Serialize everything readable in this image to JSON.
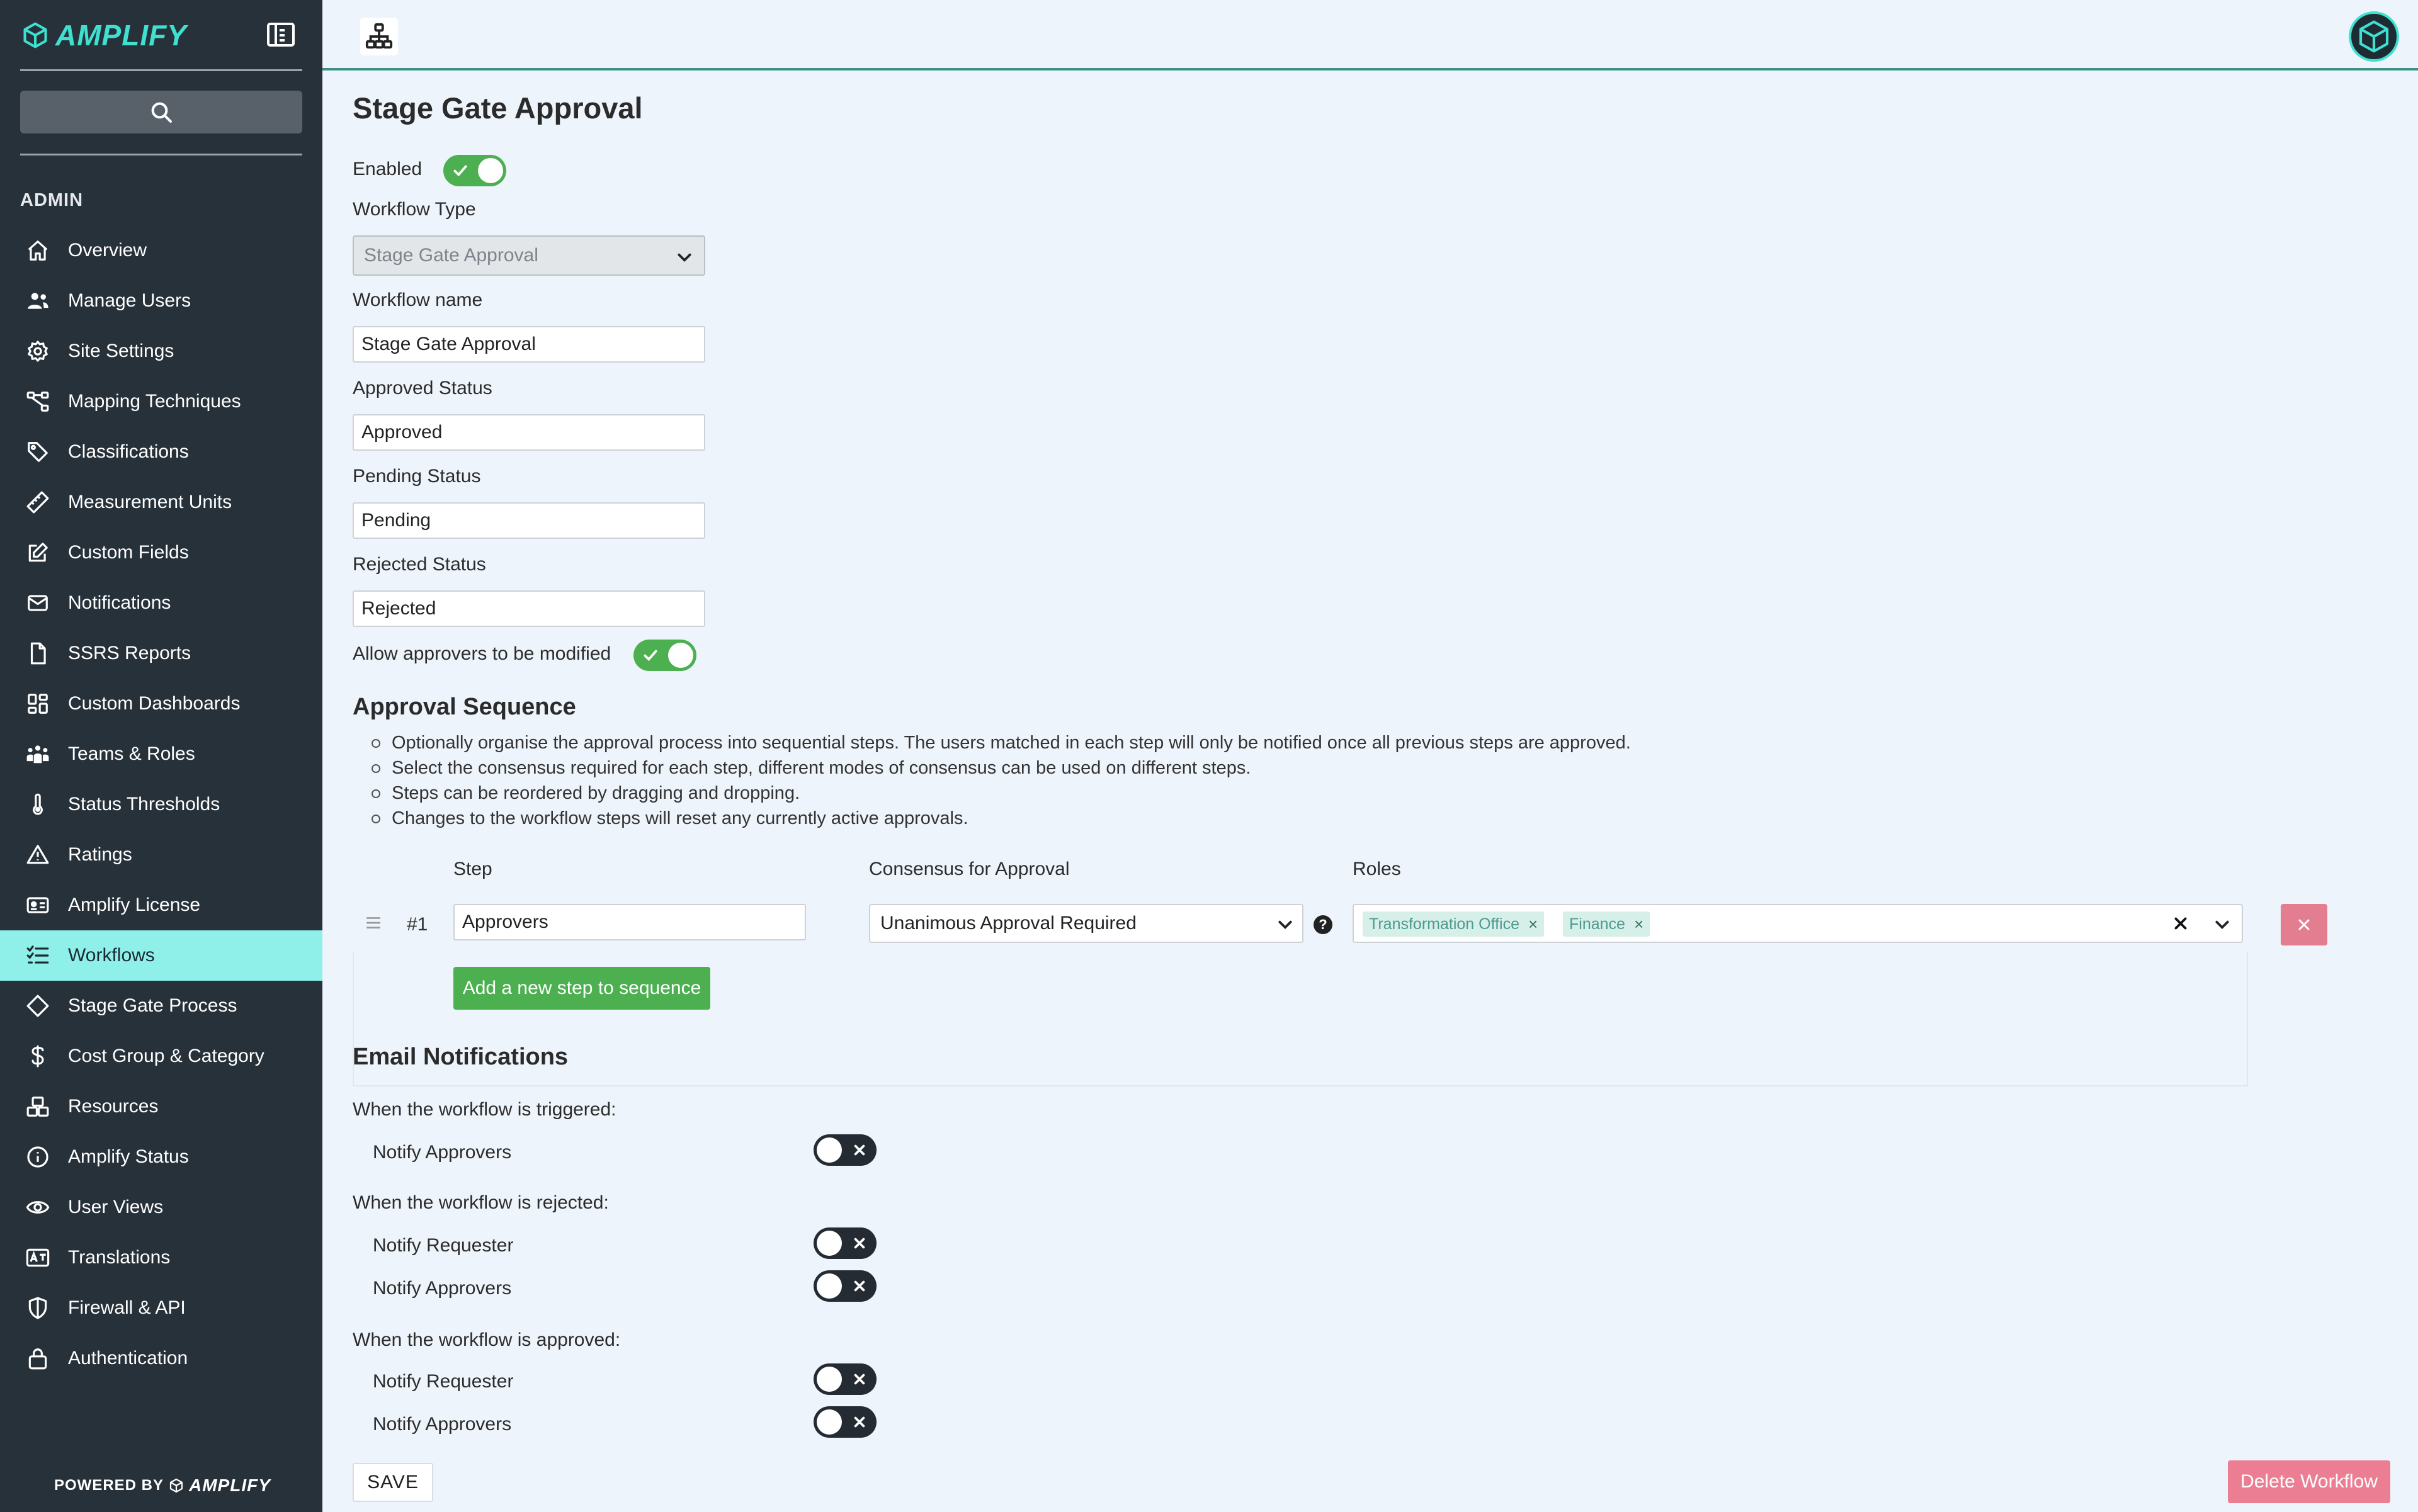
{
  "sidebar": {
    "brand": "AMPLIFY",
    "section_heading": "ADMIN",
    "items": [
      {
        "label": "Overview",
        "icon": "home-icon"
      },
      {
        "label": "Manage Users",
        "icon": "users-icon"
      },
      {
        "label": "Site Settings",
        "icon": "gear-icon"
      },
      {
        "label": "Mapping Techniques",
        "icon": "network-icon"
      },
      {
        "label": "Classifications",
        "icon": "tag-icon"
      },
      {
        "label": "Measurement Units",
        "icon": "ruler-icon"
      },
      {
        "label": "Custom Fields",
        "icon": "edit-icon"
      },
      {
        "label": "Notifications",
        "icon": "envelope-icon"
      },
      {
        "label": "SSRS Reports",
        "icon": "file-icon"
      },
      {
        "label": "Custom Dashboards",
        "icon": "dashboard-icon"
      },
      {
        "label": "Teams & Roles",
        "icon": "team-icon"
      },
      {
        "label": "Status Thresholds",
        "icon": "thermometer-icon"
      },
      {
        "label": "Ratings",
        "icon": "warning-icon"
      },
      {
        "label": "Amplify License",
        "icon": "id-card-icon"
      },
      {
        "label": "Workflows",
        "icon": "list-check-icon",
        "active": true
      },
      {
        "label": "Stage Gate Process",
        "icon": "diamond-icon"
      },
      {
        "label": "Cost Group & Category",
        "icon": "dollar-icon"
      },
      {
        "label": "Resources",
        "icon": "boxes-icon"
      },
      {
        "label": "Amplify Status",
        "icon": "info-circle-icon"
      },
      {
        "label": "User Views",
        "icon": "eye-icon"
      },
      {
        "label": "Translations",
        "icon": "translate-icon"
      },
      {
        "label": "Firewall & API",
        "icon": "shield-icon"
      },
      {
        "label": "Authentication",
        "icon": "lock-icon"
      }
    ],
    "powered_by": "POWERED BY",
    "powered_brand": "AMPLIFY"
  },
  "page": {
    "title": "Stage Gate Approval",
    "enabled_label": "Enabled",
    "enabled": true,
    "workflow_type_label": "Workflow Type",
    "workflow_type_value": "Stage Gate Approval",
    "workflow_name_label": "Workflow name",
    "workflow_name_value": "Stage Gate Approval",
    "approved_status_label": "Approved Status",
    "approved_status_value": "Approved",
    "pending_status_label": "Pending Status",
    "pending_status_value": "Pending",
    "rejected_status_label": "Rejected Status",
    "rejected_status_value": "Rejected",
    "allow_modify_label": "Allow approvers to be modified",
    "allow_modify": true
  },
  "sequence": {
    "heading": "Approval Sequence",
    "notes": [
      "Optionally organise the approval process into sequential steps. The users matched in each step will only be notified once all previous steps are approved.",
      "Select the consensus required for each step, different modes of consensus can be used on different steps.",
      "Steps can be reordered by dragging and dropping.",
      "Changes to the workflow steps will reset any currently active approvals."
    ],
    "col_step": "Step",
    "col_consensus": "Consensus for Approval",
    "col_roles": "Roles",
    "steps": [
      {
        "number": "#1",
        "name": "Approvers",
        "consensus": "Unanimous Approval Required",
        "roles": [
          "Transformation Office",
          "Finance"
        ]
      }
    ],
    "add_step_label": "Add a new step to sequence",
    "help_glyph": "?",
    "tag_remove_glyph": "×"
  },
  "email": {
    "heading": "Email Notifications",
    "groups": [
      {
        "label": "When the workflow is triggered:",
        "toggles": [
          {
            "label": "Notify Approvers",
            "on": false
          }
        ]
      },
      {
        "label": "When the workflow is rejected:",
        "toggles": [
          {
            "label": "Notify Requester",
            "on": false
          },
          {
            "label": "Notify Approvers",
            "on": false
          }
        ]
      },
      {
        "label": "When the workflow is approved:",
        "toggles": [
          {
            "label": "Notify Requester",
            "on": false
          },
          {
            "label": "Notify Approvers",
            "on": false
          }
        ]
      }
    ]
  },
  "actions": {
    "save_label": "SAVE",
    "delete_label": "Delete Workflow"
  },
  "colors": {
    "sidebar_bg": "#27313a",
    "accent_teal": "#40e0d0",
    "active_item": "#8ff0ea",
    "toggle_on": "#4caf50",
    "toggle_off": "#242b33",
    "danger": "#ec7e94"
  }
}
